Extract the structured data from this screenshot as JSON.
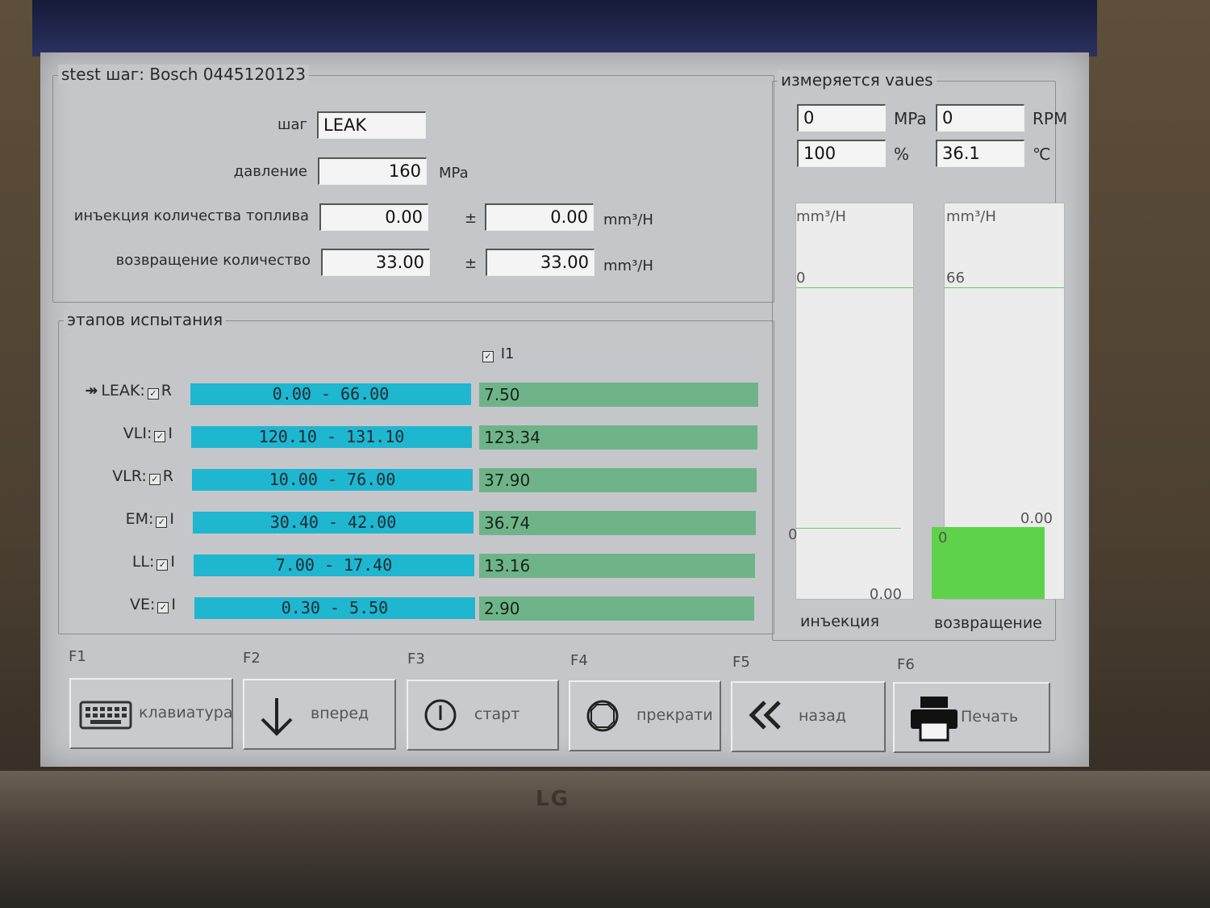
{
  "test_group": {
    "title": "stest шаг: Bosch 0445120123",
    "step_label": "шаг",
    "step_value": "LEAK",
    "pressure_label": "давление",
    "pressure_value": "160",
    "pressure_unit": "MPa",
    "injection_label": "инъекция количества топлива",
    "injection_value": "0.00",
    "injection_tol": "0.00",
    "return_label": "возвращение количество",
    "return_value": "33.00",
    "return_tol": "33.00",
    "pm": "±",
    "flow_unit": "mm³/H"
  },
  "steps_group": {
    "title": "этапов испытания",
    "column_header": "I1",
    "rows": [
      {
        "name": "LEAK:",
        "mode": "R",
        "range": "0.00 - 66.00",
        "value": "7.50",
        "active": true
      },
      {
        "name": "VLI:",
        "mode": "I",
        "range": "120.10 - 131.10",
        "value": "123.34",
        "active": false
      },
      {
        "name": "VLR:",
        "mode": "R",
        "range": "10.00 - 76.00",
        "value": "37.90",
        "active": false
      },
      {
        "name": "EM:",
        "mode": "I",
        "range": "30.40 - 42.00",
        "value": "36.74",
        "active": false
      },
      {
        "name": "LL:",
        "mode": "I",
        "range": "7.00 - 17.40",
        "value": "13.16",
        "active": false
      },
      {
        "name": "VE:",
        "mode": "I",
        "range": "0.30 - 5.50",
        "value": "2.90",
        "active": false
      }
    ]
  },
  "measured_group": {
    "title": "измеряется vaues",
    "pressure": "0",
    "pressure_unit": "MPa",
    "rpm": "0",
    "rpm_unit": "RPM",
    "percent": "100",
    "percent_unit": "%",
    "temperature": "36.1",
    "temperature_unit": "℃",
    "gauge_injection": {
      "unit": "mm³/H",
      "top": "0",
      "bottom": "0",
      "reading": "0.00",
      "label": "инъекция",
      "fill_fraction": 0
    },
    "gauge_return": {
      "unit": "mm³/H",
      "top": "66",
      "bottom": "0",
      "reading": "0.00",
      "label": "возвращение",
      "fill_fraction": 0.33
    }
  },
  "function_keys": [
    {
      "key": "F1",
      "label": "клавиатура",
      "icon": "keyboard-icon"
    },
    {
      "key": "F2",
      "label": "вперед",
      "icon": "arrow-down-icon"
    },
    {
      "key": "F3",
      "label": "старт",
      "icon": "power-icon"
    },
    {
      "key": "F4",
      "label": "прекрати",
      "icon": "stop-icon"
    },
    {
      "key": "F5",
      "label": "назад",
      "icon": "double-chevron-left-icon"
    },
    {
      "key": "F6",
      "label": "Печать",
      "icon": "printer-icon"
    }
  ],
  "monitor_brand": "LG",
  "colors": {
    "range_bar": "#1fb6d0",
    "value_bar": "#6fb489",
    "gauge_fill": "#5fd24b",
    "screen_bg": "#c5c6c9"
  }
}
